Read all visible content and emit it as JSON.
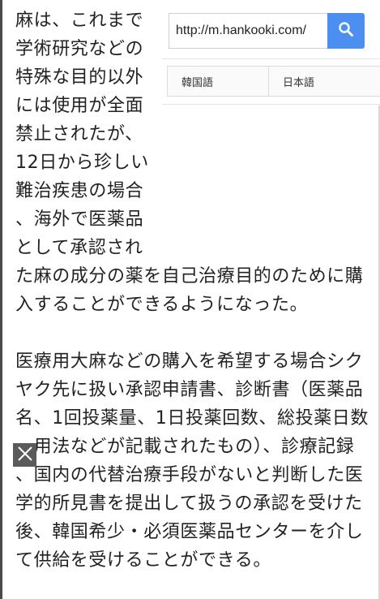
{
  "translator": {
    "url_value": "http://m.hankooki.com/",
    "search_icon": "search-icon",
    "tabs": [
      {
        "label": "韓国語"
      },
      {
        "label": "日本語"
      }
    ]
  },
  "article": {
    "paragraph1": "麻は、これまで学術研究などの特殊な目的以外には使用が全面禁止されたが、12日から珍しい難治疾患の場合、海外で医薬品として承認された麻の成分の薬を自己治療目的のために購入することができるようになった。",
    "paragraph2": "医療用大麻などの購入を希望する場合シクヤク先に扱い承認申請書、診断書（医薬品名、1回投薬量、1日投薬回数、総投薬日数、用法などが記載されたもの）、診療記録、国内の代替治療手段がないと判断した医学的所見書を提出して扱うの承認を受けた後、韓国希少・必須医薬品センターを介して供給を受けることができる。"
  },
  "overlay": {
    "close_icon": "close-icon"
  },
  "colors": {
    "search_button": "#4c8ff0",
    "close_badge": "#5a5a5a"
  }
}
